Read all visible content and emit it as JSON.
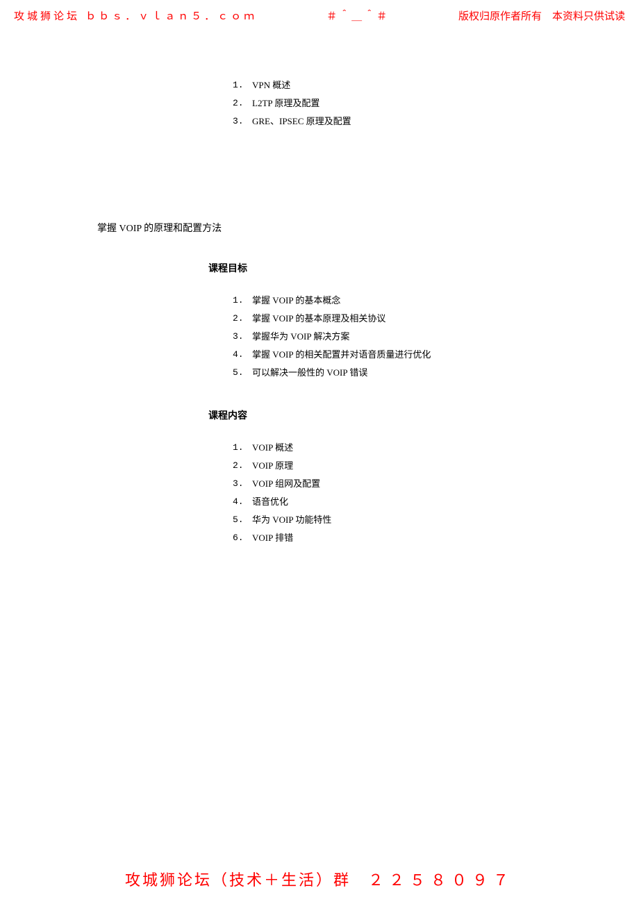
{
  "header": {
    "left": "攻城狮论坛 ｂｂｓ．ｖｌａｎ５．ｃｏｍ",
    "center": "＃＾＿＾＃",
    "right": "版权归原作者所有　本资料只供试读"
  },
  "top_list": [
    {
      "num": "1.",
      "text": "VPN 概述"
    },
    {
      "num": "2.",
      "text": "L2TP 原理及配置"
    },
    {
      "num": "3.",
      "text": "GRE、IPSEC 原理及配置"
    }
  ],
  "section_title": "掌握 VOIP 的原理和配置方法",
  "goals_heading": "课程目标",
  "goals_list": [
    {
      "num": "1.",
      "text": "掌握 VOIP 的基本概念"
    },
    {
      "num": "2.",
      "text": "掌握 VOIP 的基本原理及相关协议"
    },
    {
      "num": "3.",
      "text": "掌握华为 VOIP 解决方案"
    },
    {
      "num": "4.",
      "text": "掌握 VOIP 的相关配置并对语音质量进行优化"
    },
    {
      "num": "5.",
      "text": "可以解决一般性的 VOIP 错误"
    }
  ],
  "content_heading": "课程内容",
  "content_list": [
    {
      "num": "1.",
      "text": "VOIP 概述"
    },
    {
      "num": "2.",
      "text": "VOIP 原理"
    },
    {
      "num": "3.",
      "text": "VOIP 组网及配置"
    },
    {
      "num": "4.",
      "text": "语音优化"
    },
    {
      "num": "5.",
      "text": "华为 VOIP 功能特性"
    },
    {
      "num": "6.",
      "text": "VOIP 排错"
    }
  ],
  "footer": {
    "text": "攻城狮论坛（技术＋生活）群　",
    "digits": "２２５８０９７"
  }
}
